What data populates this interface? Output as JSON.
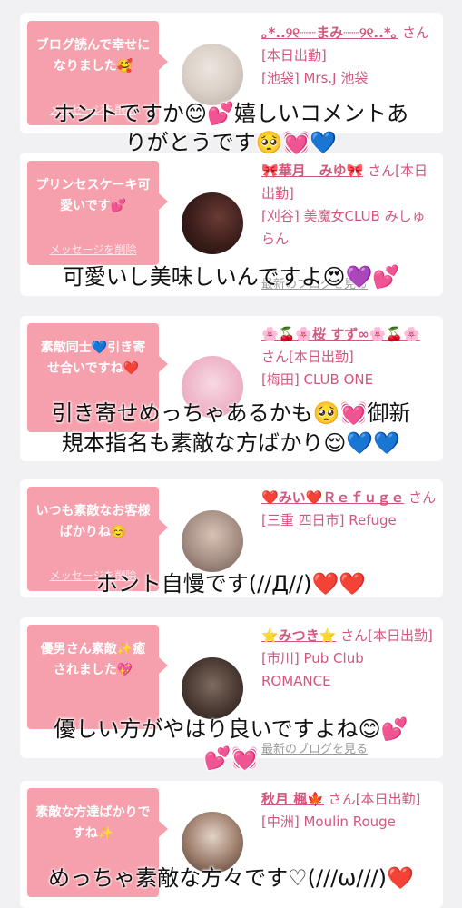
{
  "common": {
    "delete_label": "メッセージを削除",
    "blog_link": "最新のブログを見る"
  },
  "cards": [
    {
      "message": "ブログ読んで幸せになりました🥰",
      "name": "｡*..୨୧┈┈まみ┈┈୨୧..*｡",
      "suffix": "さん[本日出勤]",
      "shop": "[池袋] Mrs.J 池袋"
    },
    {
      "message": "プリンセスケーキ可愛いです💕",
      "name": "🎀華月　みゆ🎀",
      "suffix": "さん[本日出勤]",
      "shop": "[刈谷] 美魔女CLUB みしゅらん"
    },
    {
      "message": "素敵同士💙引き寄せ合いですね❤️",
      "name": "🌸🍒🌸桜 すず∞🌸🍒🌸",
      "suffix": "さん[本日出勤]",
      "shop": "[梅田] CLUB ONE"
    },
    {
      "message": "いつも素敵なお客様ばかりね☺️",
      "name": "❤️みい❤️Ｒｅｆｕｇｅ",
      "suffix": "さん",
      "shop": "[三重 四日市] Refuge"
    },
    {
      "message": "優男さん素敵✨癒されました💖",
      "name": "⭐️みつき⭐️",
      "suffix": "さん[本日出勤]",
      "shop": "[市川] Pub Club ROMANCE"
    },
    {
      "message": "素敵な方達ばかりですね✨",
      "name": "秋月 楓🍁",
      "suffix": "さん[本日出勤]",
      "shop": "[中洲] Moulin Rouge"
    }
  ],
  "captions": [
    "ホントですか😊💕嬉しいコメントあ",
    "りがとうです🥺💓💙",
    "可愛いし美味しいんですよ😍💜💕",
    "引き寄せめっちゃあるかも🥺💓御新",
    "規本指名も素敵な方ばかり😌💙💙",
    "ホント自慢です(//Д//)❤️❤️",
    "優しい方がやはり良いですよね😊💕",
    "💕💓",
    "めっちゃ素敵な方々です♡(///ω///)❤️"
  ]
}
